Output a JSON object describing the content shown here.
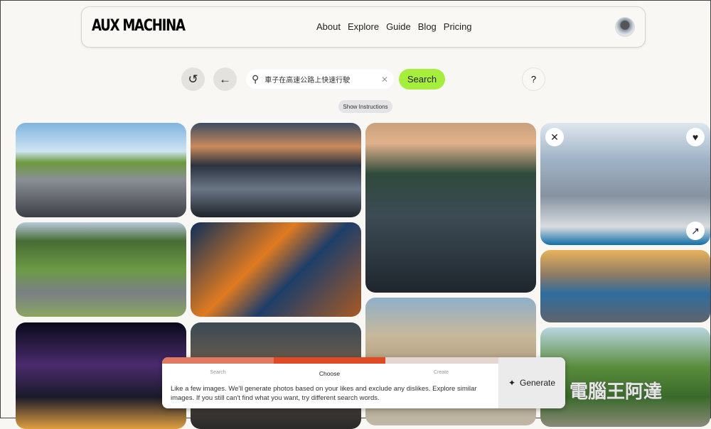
{
  "header": {
    "logo": "AUX MACHINA",
    "links": [
      "About",
      "Explore",
      "Guide",
      "Blog",
      "Pricing"
    ]
  },
  "toolbar": {
    "search_value": "車子在高速公路上快速行駛",
    "search_label": "Search",
    "help": "?",
    "show_instructions": "Show Instructions"
  },
  "images": [
    {
      "bg": "linear-gradient(180deg,#7fb3e0 0%,#cfe4f2 30%,#6c9a3c 42%,#8a8f96 60%,#3d4046 100%)"
    },
    {
      "bg": "linear-gradient(180deg,#3b4c63 0%,#c98a5c 25%,#2c3340 45%,#6a7686 70%,#1f2329 100%)"
    },
    {
      "bg": "linear-gradient(180deg,#c9a07a 0%,#e0b28c 12%,#2f4a3c 30%,#3d4b55 55%,#1f262c 100%)"
    },
    {
      "bg": "linear-gradient(180deg,#dfe7ee 0%,#9fb3c6 30%,#8792a0 60%,#d8dce0 85%,#0f6ea8 100%)"
    },
    {
      "bg": "linear-gradient(180deg,#b8c9d8 0%,#486b35 20%,#6c9a45 50%,#7b8086 75%,#8aa660 100%)"
    },
    {
      "bg": "linear-gradient(135deg,#0d2f5a 0%,#e07a20 40%,#1e3e6a 60%,#a85a24 100%)"
    },
    {
      "bg": "linear-gradient(180deg,#e9b35a 0%,#8b7a66 35%,#2f6d9e 60%,#5e646c 100%)"
    },
    {
      "bg": "linear-gradient(180deg,#0a0a1a 0%,#4a2b6e 40%,#1a1a2a 70%,#e0a040 100%)"
    },
    {
      "bg": "linear-gradient(180deg,#3a4a55 0%,#6a5a4a 40%,#2a2a2a 100%)"
    },
    {
      "bg": "linear-gradient(180deg,#8fb0c8 0%,#c8b89a 30%,#a89678 60%,#c0b8a8 100%)"
    },
    {
      "bg": "linear-gradient(180deg,#b9d6e0 0%,#5a8c3c 40%,#3a6a2a 70%,#8a8a7a 100%)"
    }
  ],
  "panel": {
    "steps": [
      "Search",
      "Choose",
      "Create"
    ],
    "description": "Like a few images. We'll generate photos based on your likes and exclude any dislikes. Explore similar images. If you still can't find what you want, try different search words.",
    "generate": "Generate",
    "colors": {
      "search": "#e07a63",
      "choose": "#e04a24",
      "create": "#e6d6d2"
    }
  },
  "watermark": "電腦王阿達"
}
